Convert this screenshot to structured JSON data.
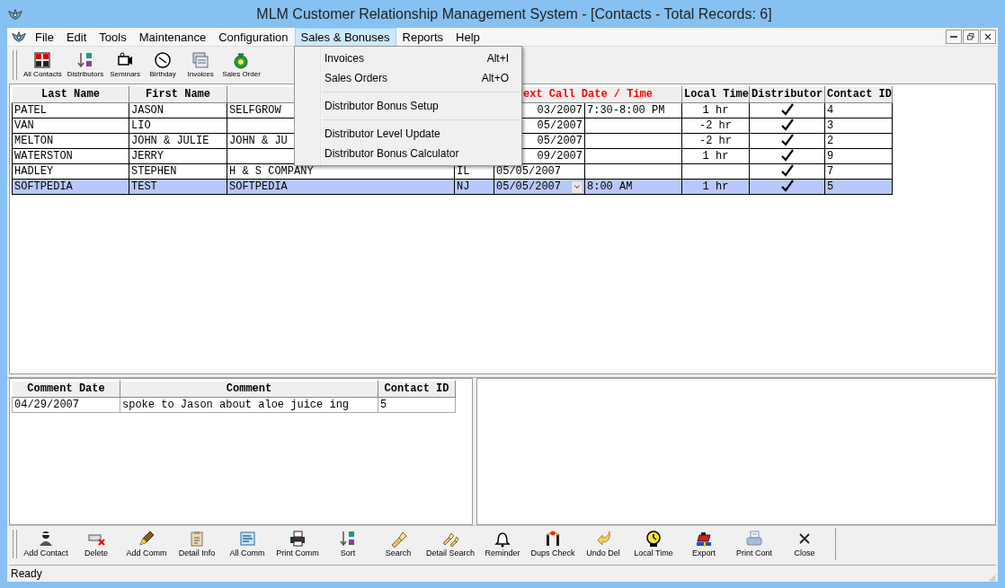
{
  "window": {
    "title": "MLM Customer Relationship Management System - [Contacts - Total Records: 6]"
  },
  "menu_bar": [
    {
      "label": "File",
      "selected": false
    },
    {
      "label": "Edit",
      "selected": false
    },
    {
      "label": "Tools",
      "selected": false
    },
    {
      "label": "Maintenance",
      "selected": false
    },
    {
      "label": "Configuration",
      "selected": false
    },
    {
      "label": "Sales & Bonuses",
      "selected": true
    },
    {
      "label": "Reports",
      "selected": false
    },
    {
      "label": "Help",
      "selected": false
    }
  ],
  "open_menu": [
    {
      "kind": "item",
      "label": "Invoices",
      "shortcut": "Alt+I"
    },
    {
      "kind": "item",
      "label": "Sales Orders",
      "shortcut": "Alt+O"
    },
    {
      "kind": "separator"
    },
    {
      "kind": "item",
      "label": "Distributor Bonus Setup"
    },
    {
      "kind": "separator"
    },
    {
      "kind": "item",
      "label": "Distributor Level Update"
    },
    {
      "kind": "item",
      "label": "Distributor Bonus Calculator"
    }
  ],
  "top_toolbar": [
    "All Contacts",
    "Distributors",
    "Seminars",
    "Birthday",
    "Invoices",
    "Sales Order"
  ],
  "contacts_table": {
    "columns": [
      {
        "label": "Last Name"
      },
      {
        "label": "First Name"
      },
      {},
      {},
      {
        "label": "ext Call Date / Time",
        "color": "#ff0000"
      },
      {
        "label": "Local Time"
      },
      {
        "label": "Distributor"
      },
      {
        "label": "Contact ID"
      }
    ],
    "rows": [
      {
        "cells": [
          "PATEL",
          "JASON",
          "SELFGROW",
          "",
          [
            "03/2007",
            "7:30-8:00 PM"
          ],
          "1 hr"
        ],
        "distributor": true,
        "contact_id": "4",
        "selected": false,
        "date_dropdown": false
      },
      {
        "cells": [
          "VAN",
          "LIO",
          "",
          "",
          [
            "05/2007",
            ""
          ],
          "-2 hr"
        ],
        "distributor": true,
        "contact_id": "3",
        "selected": false,
        "date_dropdown": false
      },
      {
        "cells": [
          "MELTON",
          "JOHN & JULIE",
          "JOHN & JU",
          "",
          [
            "05/2007",
            ""
          ],
          "-2 hr"
        ],
        "distributor": true,
        "contact_id": "2",
        "selected": false,
        "date_dropdown": false
      },
      {
        "cells": [
          "WATERSTON",
          "JERRY",
          "",
          "",
          [
            "09/2007",
            ""
          ],
          "1 hr"
        ],
        "distributor": true,
        "contact_id": "9",
        "selected": false,
        "date_dropdown": false
      },
      {
        "cells": [
          "HADLEY",
          "STEPHEN",
          "H & S COMPANY",
          "IL",
          [
            "05/05/2007",
            ""
          ],
          ""
        ],
        "distributor": true,
        "contact_id": "7",
        "selected": false,
        "date_dropdown": false
      },
      {
        "cells": [
          "SOFTPEDIA",
          "TEST",
          "SOFTPEDIA",
          "NJ",
          [
            "05/05/2007",
            "8:00 AM"
          ],
          "1 hr"
        ],
        "distributor": true,
        "contact_id": "5",
        "selected": true,
        "date_dropdown": true
      }
    ]
  },
  "comments_table": {
    "columns": [
      "Comment Date",
      "Comment",
      "Contact ID"
    ],
    "rows": [
      [
        "04/29/2007",
        "spoke to Jason about aloe juice ing",
        "5"
      ]
    ]
  },
  "bottom_toolbar": [
    "Add Contact",
    "Delete",
    "Add Comm",
    "Detail Info",
    "All Comm",
    "Print Comm",
    "Sort",
    "Search",
    "Detail Search",
    "Reminder",
    "Dups Check",
    "Undo Del",
    "Local Time",
    "Export",
    "Print Cont",
    "Close"
  ],
  "status_bar": "Ready"
}
